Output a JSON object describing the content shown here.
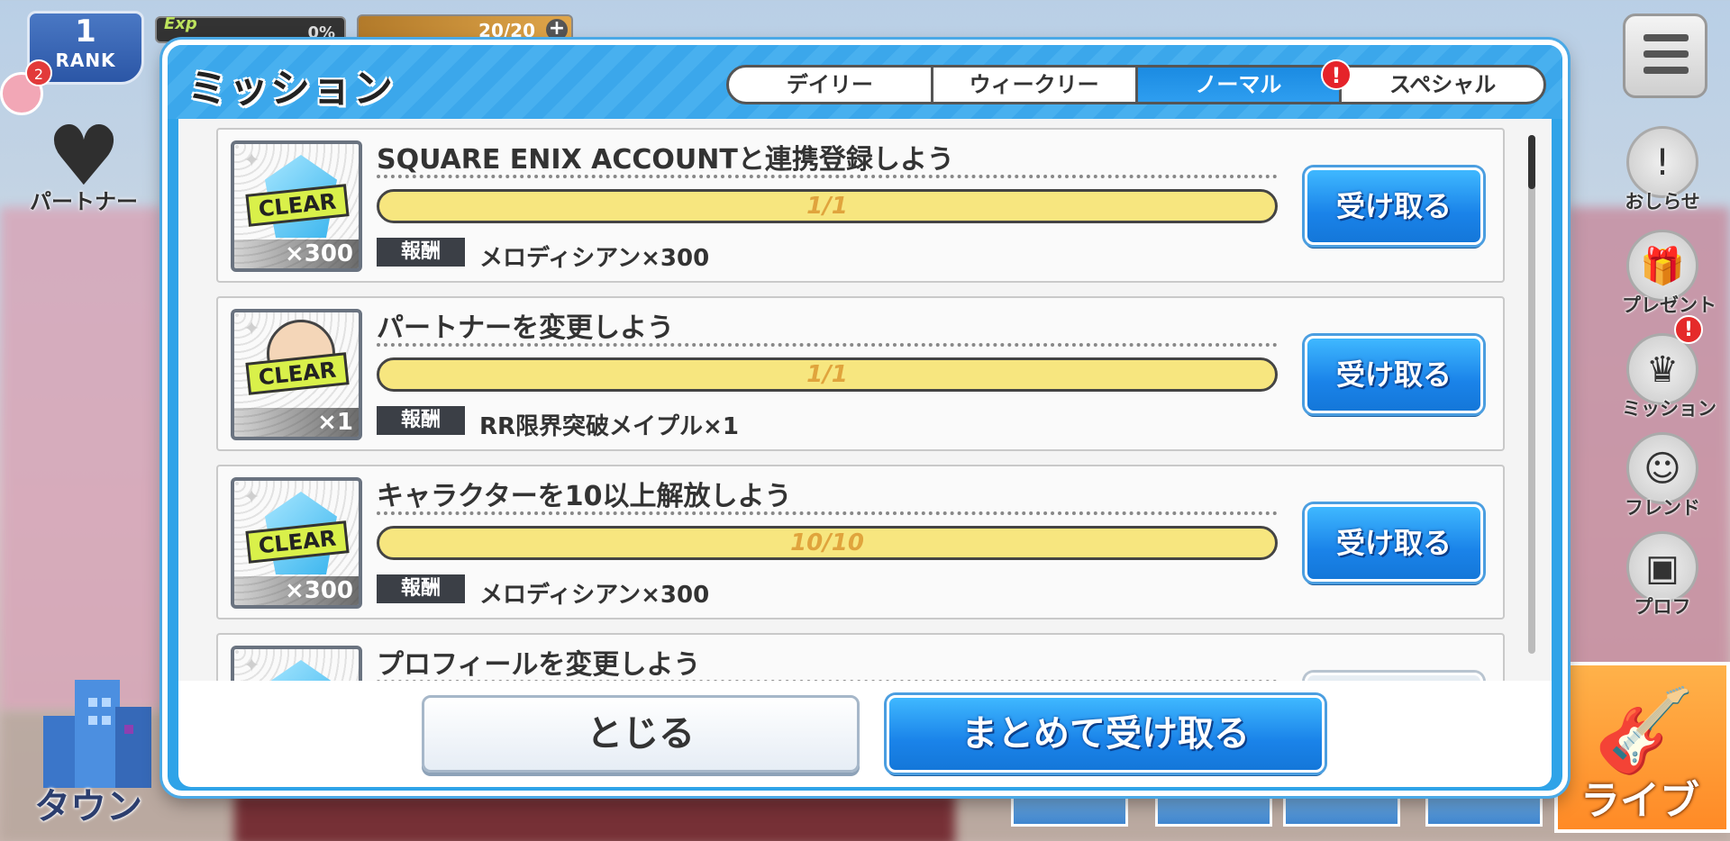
{
  "hud": {
    "rank_value": "1",
    "rank_label": "RANK",
    "exp_label": "Exp",
    "exp_value": "0%",
    "stamina_value": "20/20",
    "stamina_plus": "+",
    "notification_count": "2"
  },
  "left_menu": {
    "partner_label": "パートナー",
    "town_label": "タウン"
  },
  "right_menu": {
    "items": [
      {
        "label": "おしらせ",
        "icon": "notice-icon"
      },
      {
        "label": "プレゼント",
        "icon": "gift-icon"
      },
      {
        "label": "ミッション",
        "icon": "mission-icon"
      },
      {
        "label": "フレンド",
        "icon": "friend-icon"
      },
      {
        "label": "プロフ",
        "icon": "profile-icon"
      }
    ],
    "mission_alert": "!",
    "live_label": "ライブ"
  },
  "dialog": {
    "title": "ミッション",
    "tabs": [
      "デイリー",
      "ウィークリー",
      "ノーマル",
      "スペシャル"
    ],
    "active_tab": "ノーマル",
    "tab_alert": "!",
    "reward_tag": "報酬",
    "claim_label": "受け取る",
    "missions": [
      {
        "title": "SQUARE ENIX ACCOUNTと連携登録しよう",
        "progress": "1/1",
        "reward": "メロディシアン×300",
        "badge": "CLEAR",
        "qty": "×300",
        "icon": "crystal-icon"
      },
      {
        "title": "パートナーを変更しよう",
        "progress": "1/1",
        "reward": "RR限界突破メイプル×1",
        "badge": "CLEAR",
        "qty": "×1",
        "icon": "maple-character-icon"
      },
      {
        "title": "キャラクターを10以上解放しよう",
        "progress": "10/10",
        "reward": "メロディシアン×300",
        "badge": "CLEAR",
        "qty": "×300",
        "icon": "crystal-icon"
      },
      {
        "title": "プロフィールを変更しよう",
        "icon": "crystal-icon"
      }
    ],
    "close_label": "とじる",
    "claim_all_label": "まとめて受け取る"
  },
  "colors": {
    "dialog_blue": "#2fa3e8",
    "button_blue": "#1a83e9",
    "progress_fill": "#f7e67f",
    "clear_badge": "#d9f04a",
    "alert_red": "#e5232a"
  }
}
